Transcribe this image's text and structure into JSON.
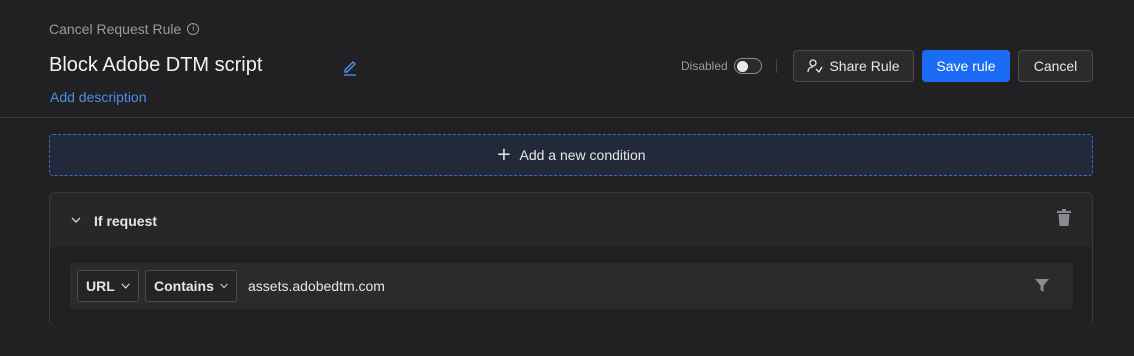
{
  "header": {
    "rule_type": "Cancel Request Rule",
    "rule_name": "Block Adobe DTM script",
    "add_description": "Add description",
    "status_label": "Disabled",
    "share_label": "Share Rule",
    "save_label": "Save rule",
    "cancel_label": "Cancel"
  },
  "add_condition": {
    "label": "Add a new condition"
  },
  "condition": {
    "title": "If request",
    "source": "URL",
    "operator": "Contains",
    "value": "assets.adobedtm.com"
  },
  "icons": {
    "info": "info-icon",
    "edit": "pencil-icon",
    "share": "share-user-icon",
    "plus": "plus-icon",
    "chevron": "chevron-down-icon",
    "trash": "trash-icon",
    "filter": "filter-icon"
  },
  "colors": {
    "accent": "#1a6cf5",
    "link": "#4a8fe7",
    "background": "#212124"
  }
}
